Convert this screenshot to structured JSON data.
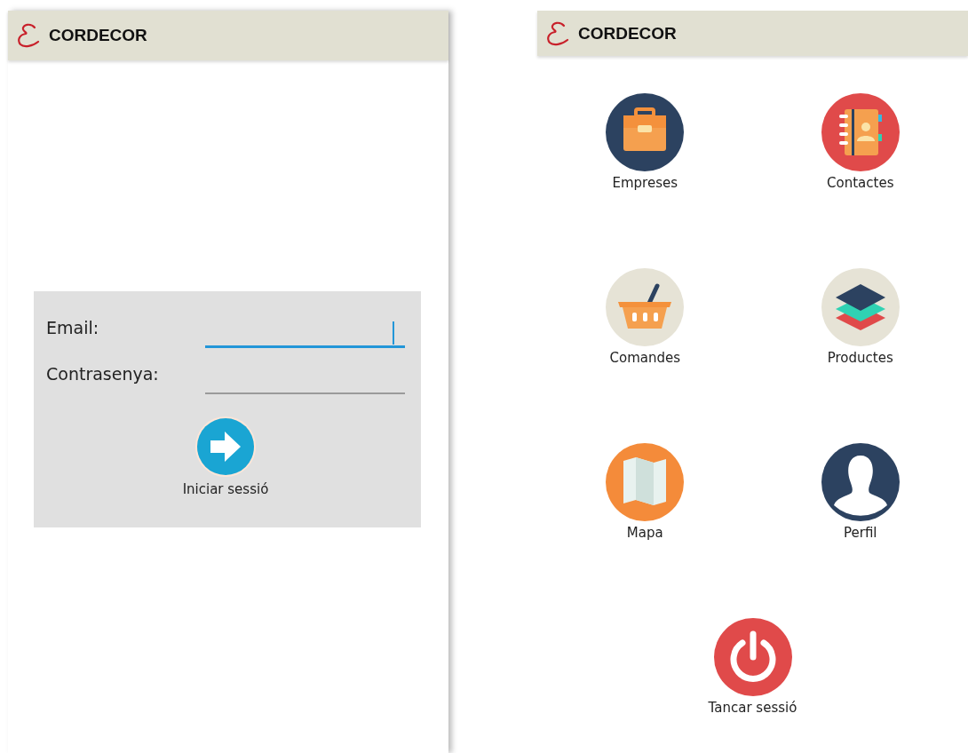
{
  "login_screen": {
    "app_bar": {
      "title": "CORDECOR"
    },
    "fields": [
      {
        "label": "Email:",
        "focused": true
      },
      {
        "label": "Contrasenya:",
        "focused": false
      }
    ],
    "submit_button": {
      "label": "Iniciar sessió"
    }
  },
  "menu_screen": {
    "app_bar": {
      "title": "CORDECOR"
    },
    "items": [
      {
        "label": "Empreses",
        "kind": "briefcase"
      },
      {
        "label": "Contactes",
        "kind": "addressbook"
      },
      {
        "label": "Comandes",
        "kind": "basket"
      },
      {
        "label": "Productes",
        "kind": "layers"
      },
      {
        "label": "Mapa",
        "kind": "map"
      },
      {
        "label": "Perfil",
        "kind": "person"
      }
    ],
    "logout_button": {
      "label": "Tancar sessió",
      "kind": "power"
    }
  }
}
